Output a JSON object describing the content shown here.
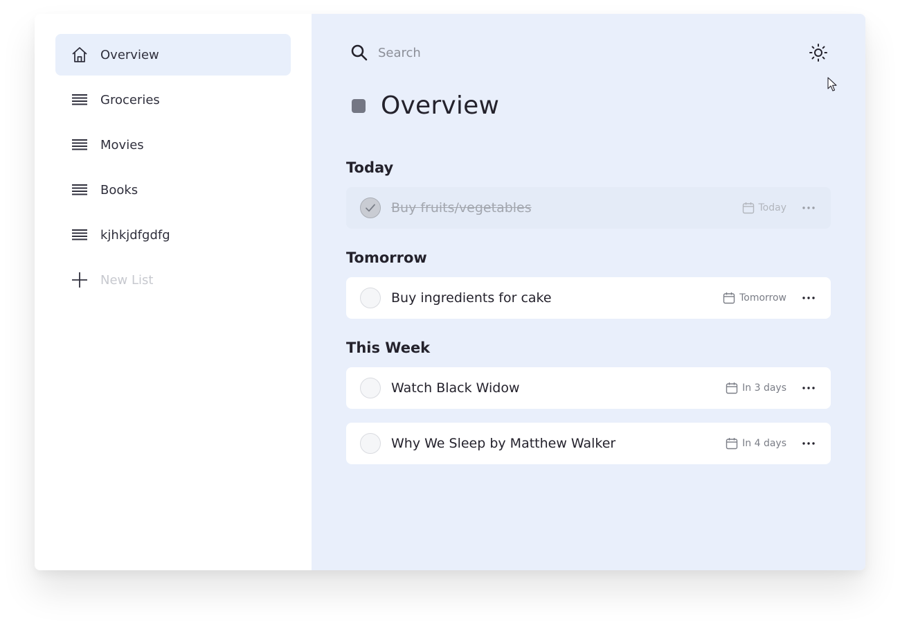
{
  "sidebar": {
    "items": [
      {
        "label": "Overview",
        "icon": "home-icon",
        "active": true
      },
      {
        "label": "Groceries",
        "icon": "list-icon"
      },
      {
        "label": "Movies",
        "icon": "list-icon"
      },
      {
        "label": "Books",
        "icon": "list-icon"
      },
      {
        "label": "kjhkjdfgdfg",
        "icon": "list-icon"
      }
    ],
    "new_list_label": "New List"
  },
  "search": {
    "placeholder": "Search",
    "value": ""
  },
  "page": {
    "title": "Overview"
  },
  "sections": [
    {
      "heading": "Today",
      "tasks": [
        {
          "title": "Buy fruits/vegetables",
          "due": "Today",
          "completed": true
        }
      ]
    },
    {
      "heading": "Tomorrow",
      "tasks": [
        {
          "title": "Buy ingredients for cake",
          "due": "Tomorrow",
          "completed": false
        }
      ]
    },
    {
      "heading": "This Week",
      "tasks": [
        {
          "title": "Watch Black Widow",
          "due": "In 3 days",
          "completed": false
        },
        {
          "title": "Why We Sleep by Matthew Walker",
          "due": "In 4 days",
          "completed": false
        }
      ]
    }
  ],
  "colors": {
    "accent_bg": "#e9effb",
    "active_item_bg": "#e8effb",
    "text": "#24222c"
  }
}
